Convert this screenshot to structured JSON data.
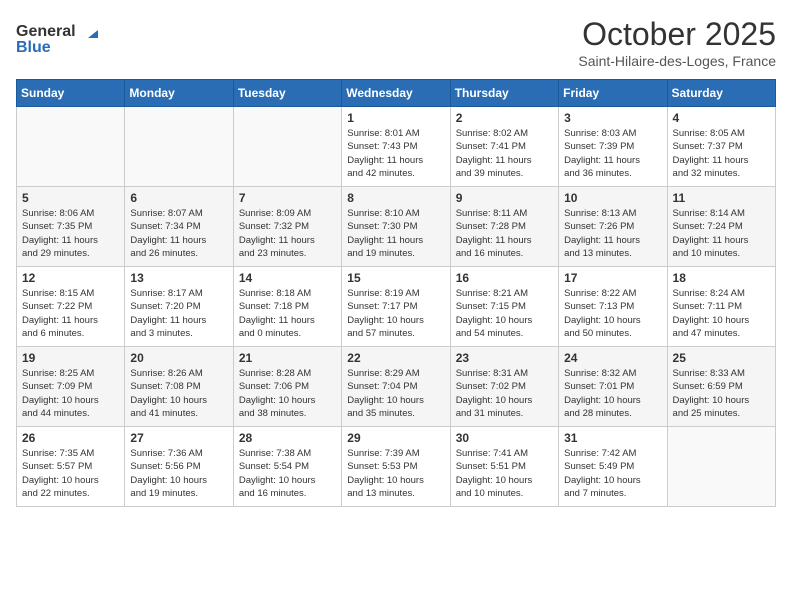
{
  "header": {
    "logo_general": "General",
    "logo_blue": "Blue",
    "month_title": "October 2025",
    "location": "Saint-Hilaire-des-Loges, France"
  },
  "days_of_week": [
    "Sunday",
    "Monday",
    "Tuesday",
    "Wednesday",
    "Thursday",
    "Friday",
    "Saturday"
  ],
  "weeks": [
    [
      {
        "day": "",
        "info": ""
      },
      {
        "day": "",
        "info": ""
      },
      {
        "day": "",
        "info": ""
      },
      {
        "day": "1",
        "info": "Sunrise: 8:01 AM\nSunset: 7:43 PM\nDaylight: 11 hours\nand 42 minutes."
      },
      {
        "day": "2",
        "info": "Sunrise: 8:02 AM\nSunset: 7:41 PM\nDaylight: 11 hours\nand 39 minutes."
      },
      {
        "day": "3",
        "info": "Sunrise: 8:03 AM\nSunset: 7:39 PM\nDaylight: 11 hours\nand 36 minutes."
      },
      {
        "day": "4",
        "info": "Sunrise: 8:05 AM\nSunset: 7:37 PM\nDaylight: 11 hours\nand 32 minutes."
      }
    ],
    [
      {
        "day": "5",
        "info": "Sunrise: 8:06 AM\nSunset: 7:35 PM\nDaylight: 11 hours\nand 29 minutes."
      },
      {
        "day": "6",
        "info": "Sunrise: 8:07 AM\nSunset: 7:34 PM\nDaylight: 11 hours\nand 26 minutes."
      },
      {
        "day": "7",
        "info": "Sunrise: 8:09 AM\nSunset: 7:32 PM\nDaylight: 11 hours\nand 23 minutes."
      },
      {
        "day": "8",
        "info": "Sunrise: 8:10 AM\nSunset: 7:30 PM\nDaylight: 11 hours\nand 19 minutes."
      },
      {
        "day": "9",
        "info": "Sunrise: 8:11 AM\nSunset: 7:28 PM\nDaylight: 11 hours\nand 16 minutes."
      },
      {
        "day": "10",
        "info": "Sunrise: 8:13 AM\nSunset: 7:26 PM\nDaylight: 11 hours\nand 13 minutes."
      },
      {
        "day": "11",
        "info": "Sunrise: 8:14 AM\nSunset: 7:24 PM\nDaylight: 11 hours\nand 10 minutes."
      }
    ],
    [
      {
        "day": "12",
        "info": "Sunrise: 8:15 AM\nSunset: 7:22 PM\nDaylight: 11 hours\nand 6 minutes."
      },
      {
        "day": "13",
        "info": "Sunrise: 8:17 AM\nSunset: 7:20 PM\nDaylight: 11 hours\nand 3 minutes."
      },
      {
        "day": "14",
        "info": "Sunrise: 8:18 AM\nSunset: 7:18 PM\nDaylight: 11 hours\nand 0 minutes."
      },
      {
        "day": "15",
        "info": "Sunrise: 8:19 AM\nSunset: 7:17 PM\nDaylight: 10 hours\nand 57 minutes."
      },
      {
        "day": "16",
        "info": "Sunrise: 8:21 AM\nSunset: 7:15 PM\nDaylight: 10 hours\nand 54 minutes."
      },
      {
        "day": "17",
        "info": "Sunrise: 8:22 AM\nSunset: 7:13 PM\nDaylight: 10 hours\nand 50 minutes."
      },
      {
        "day": "18",
        "info": "Sunrise: 8:24 AM\nSunset: 7:11 PM\nDaylight: 10 hours\nand 47 minutes."
      }
    ],
    [
      {
        "day": "19",
        "info": "Sunrise: 8:25 AM\nSunset: 7:09 PM\nDaylight: 10 hours\nand 44 minutes."
      },
      {
        "day": "20",
        "info": "Sunrise: 8:26 AM\nSunset: 7:08 PM\nDaylight: 10 hours\nand 41 minutes."
      },
      {
        "day": "21",
        "info": "Sunrise: 8:28 AM\nSunset: 7:06 PM\nDaylight: 10 hours\nand 38 minutes."
      },
      {
        "day": "22",
        "info": "Sunrise: 8:29 AM\nSunset: 7:04 PM\nDaylight: 10 hours\nand 35 minutes."
      },
      {
        "day": "23",
        "info": "Sunrise: 8:31 AM\nSunset: 7:02 PM\nDaylight: 10 hours\nand 31 minutes."
      },
      {
        "day": "24",
        "info": "Sunrise: 8:32 AM\nSunset: 7:01 PM\nDaylight: 10 hours\nand 28 minutes."
      },
      {
        "day": "25",
        "info": "Sunrise: 8:33 AM\nSunset: 6:59 PM\nDaylight: 10 hours\nand 25 minutes."
      }
    ],
    [
      {
        "day": "26",
        "info": "Sunrise: 7:35 AM\nSunset: 5:57 PM\nDaylight: 10 hours\nand 22 minutes."
      },
      {
        "day": "27",
        "info": "Sunrise: 7:36 AM\nSunset: 5:56 PM\nDaylight: 10 hours\nand 19 minutes."
      },
      {
        "day": "28",
        "info": "Sunrise: 7:38 AM\nSunset: 5:54 PM\nDaylight: 10 hours\nand 16 minutes."
      },
      {
        "day": "29",
        "info": "Sunrise: 7:39 AM\nSunset: 5:53 PM\nDaylight: 10 hours\nand 13 minutes."
      },
      {
        "day": "30",
        "info": "Sunrise: 7:41 AM\nSunset: 5:51 PM\nDaylight: 10 hours\nand 10 minutes."
      },
      {
        "day": "31",
        "info": "Sunrise: 7:42 AM\nSunset: 5:49 PM\nDaylight: 10 hours\nand 7 minutes."
      },
      {
        "day": "",
        "info": ""
      }
    ]
  ]
}
